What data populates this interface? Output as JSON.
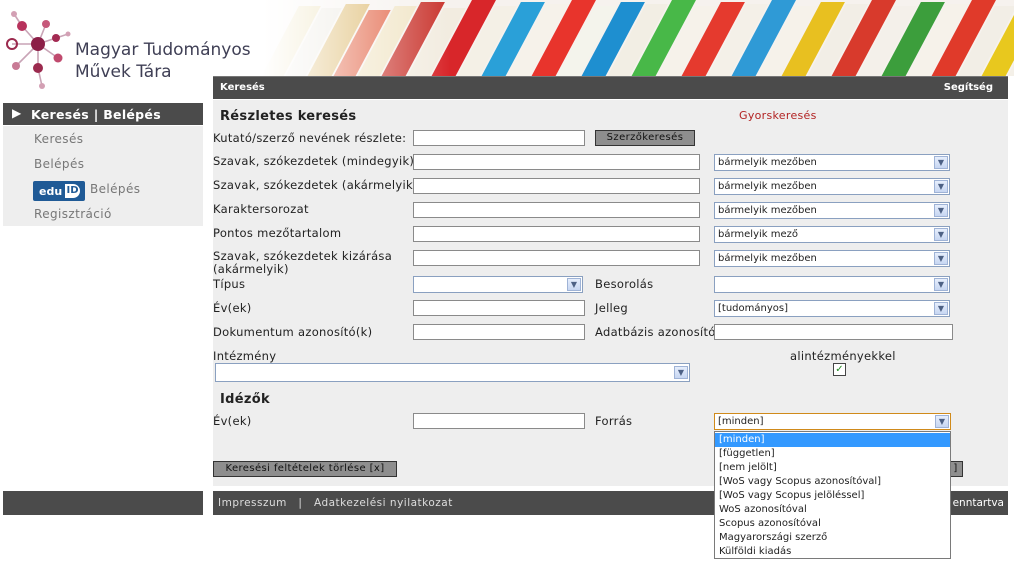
{
  "header": {
    "logo_line1": "Magyar Tudományos",
    "logo_line2": "Művek Tára"
  },
  "topbar": {
    "left": "Keresés",
    "right": "Segítség"
  },
  "sidebar": {
    "title": "Keresés | Belépés",
    "items": [
      "Keresés",
      "Belépés",
      "Belépés",
      "Regisztráció"
    ],
    "edu_label": "edu",
    "edu_id": "ID"
  },
  "form": {
    "title": "Részletes keresés",
    "quick_link": "Gyorskeresés",
    "author_label": "Kutató/szerző nevének részlete:",
    "author_button": "Szerzőkeresés",
    "words_all_label": "Szavak, szókezdetek (mindegyik)",
    "words_any_label": "Szavak, szókezdetek (akármelyik)",
    "charseq_label": "Karaktersorozat",
    "exact_label": "Pontos mezőtartalom",
    "exclude_label": "Szavak, szókezdetek kizárása (akármelyik)",
    "field_any": "bármelyik mezőben",
    "field_any_exact": "bármelyik mező",
    "type_label": "Típus",
    "classification_label": "Besorolás",
    "years_label": "Év(ek)",
    "character_label": "Jelleg",
    "character_value": "[tudományos]",
    "docid_label": "Dokumentum azonosító(k)",
    "dbid_label": "Adatbázis azonosító:",
    "institution_label": "Intézmény",
    "subinst_label": "alintézményekkel",
    "subinst_checked": true,
    "citations_title": "Idézők",
    "cit_years_label": "Év(ek)",
    "source_label": "Forrás",
    "source_value": "[minden]",
    "clear_button": "Keresési feltételek törlése [x]",
    "search_button_partial": "]"
  },
  "source_options": [
    "[minden]",
    "[független]",
    "[nem jelölt]",
    "[WoS vagy Scopus azonosítóval]",
    "[WoS vagy Scopus jelöléssel]",
    "WoS azonosítóval",
    "Scopus azonosítóval",
    "Magyarországi szerző",
    "Külföldi kiadás"
  ],
  "footer": {
    "impresszum": "Impresszum",
    "separator": "|",
    "privacy": "Adatkezelési nyilatkozat",
    "right_partial": "enntartva"
  }
}
